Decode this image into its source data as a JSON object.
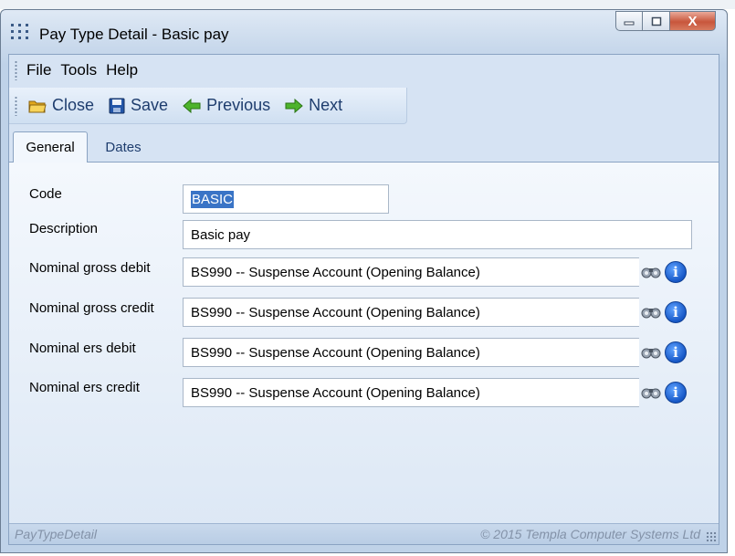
{
  "window": {
    "title": "Pay Type Detail - Basic pay",
    "close_glyph": "X"
  },
  "menu": {
    "items": [
      {
        "label": "File"
      },
      {
        "label": "Tools"
      },
      {
        "label": "Help"
      }
    ]
  },
  "toolbar": {
    "close_label": "Close",
    "save_label": "Save",
    "previous_label": "Previous",
    "next_label": "Next"
  },
  "tabs": [
    {
      "label": "General",
      "active": true
    },
    {
      "label": "Dates",
      "active": false
    }
  ],
  "form": {
    "code": {
      "label": "Code",
      "value": "BASIC",
      "selected": true
    },
    "description": {
      "label": "Description",
      "value": "Basic pay"
    },
    "nominals": [
      {
        "label": "Nominal  gross debit",
        "value": "BS990 -- Suspense Account (Opening Balance)"
      },
      {
        "label": "Nominal gross credit",
        "value": "BS990 -- Suspense Account (Opening Balance)"
      },
      {
        "label": "Nominal  ers debit",
        "value": "BS990 -- Suspense Account (Opening Balance)"
      },
      {
        "label": "Nominal ers credit",
        "value": "BS990 -- Suspense Account (Opening Balance)"
      }
    ],
    "info_glyph": "i"
  },
  "status": {
    "left": "PayTypeDetail",
    "right": "© 2015 Templa Computer Systems Ltd"
  },
  "colors": {
    "accent": "#1e3d6e",
    "selection": "#3a74c6",
    "close_button": "#c8563c"
  },
  "icons": [
    "app-grid-icon",
    "minimize-icon",
    "maximize-icon",
    "close-icon",
    "folder-icon",
    "floppy-disk-icon",
    "arrow-left-icon",
    "arrow-right-icon",
    "binoculars-icon",
    "info-icon",
    "resize-grip-icon"
  ]
}
